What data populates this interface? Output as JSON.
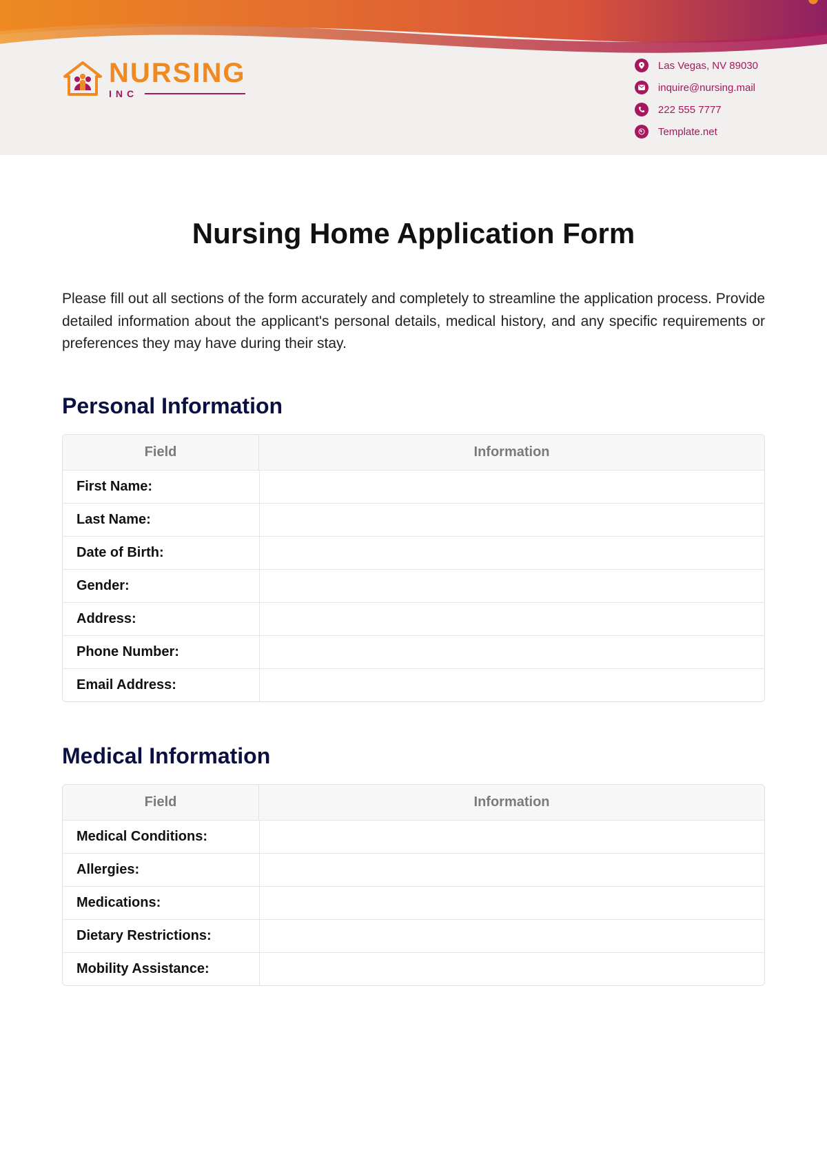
{
  "logo": {
    "main": "NURSING",
    "sub": "INC"
  },
  "contact": {
    "address": "Las Vegas, NV 89030",
    "email": "inquire@nursing.mail",
    "phone": "222 555 7777",
    "website": "Template.net"
  },
  "title": "Nursing Home Application Form",
  "intro": "Please fill out all sections of the form accurately and completely to streamline the application process. Provide detailed information about the applicant's personal details, medical history, and any specific requirements or preferences they may have during their stay.",
  "sections": {
    "personal": {
      "heading": "Personal Information",
      "col1": "Field",
      "col2": "Information",
      "rows": [
        {
          "label": "First Name:",
          "value": ""
        },
        {
          "label": "Last Name:",
          "value": ""
        },
        {
          "label": "Date of Birth:",
          "value": ""
        },
        {
          "label": "Gender:",
          "value": ""
        },
        {
          "label": "Address:",
          "value": ""
        },
        {
          "label": "Phone Number:",
          "value": ""
        },
        {
          "label": "Email Address:",
          "value": ""
        }
      ]
    },
    "medical": {
      "heading": "Medical Information",
      "col1": "Field",
      "col2": "Information",
      "rows": [
        {
          "label": "Medical Conditions:",
          "value": ""
        },
        {
          "label": "Allergies:",
          "value": ""
        },
        {
          "label": "Medications:",
          "value": ""
        },
        {
          "label": "Dietary Restrictions:",
          "value": ""
        },
        {
          "label": "Mobility Assistance:",
          "value": ""
        }
      ]
    }
  }
}
